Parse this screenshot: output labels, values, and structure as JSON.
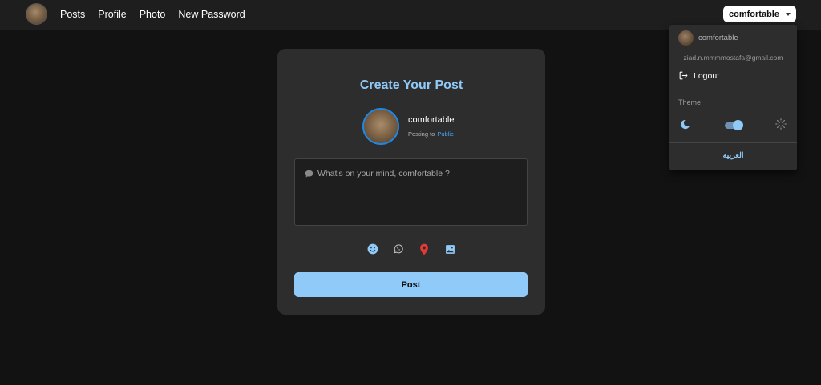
{
  "navbar": {
    "links": [
      "Posts",
      "Profile",
      "Photo",
      "New Password"
    ],
    "user_button": "comfortable"
  },
  "dropdown": {
    "username": "comfortable",
    "email": "ziad.n.mmmmostafa@gmail.com",
    "logout_label": "Logout",
    "theme_label": "Theme",
    "language_label": "العربية",
    "dark_mode_on": true
  },
  "card": {
    "title": "Create Your Post",
    "username": "comfortable",
    "posting_to_prefix": "Posting to",
    "audience": "Public",
    "placeholder": "What's on your mind, comfortable ?",
    "post_button": "Post"
  },
  "colors": {
    "accent": "#90caf9",
    "background": "#121212",
    "surface": "#2d2d2d",
    "location": "#e53935"
  },
  "icons": {
    "tools": [
      "emoji-icon",
      "whatsapp-icon",
      "location-pin-icon",
      "image-icon"
    ]
  }
}
